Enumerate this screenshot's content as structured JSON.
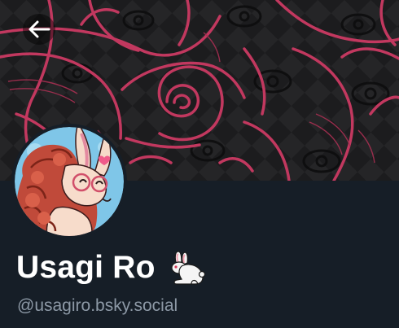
{
  "profile": {
    "display_name": "Usagi Ro",
    "name_emoji": "rabbit-emoji",
    "handle": "@usagiro.bsky.social"
  },
  "header": {
    "back_icon": "arrow-left-icon"
  },
  "colors": {
    "banner_bg": "#1b1b1d",
    "banner_accent": "#c2385f",
    "page_bg": "#161e27",
    "name_text": "#ffffff",
    "handle_text": "#8d99a6"
  }
}
